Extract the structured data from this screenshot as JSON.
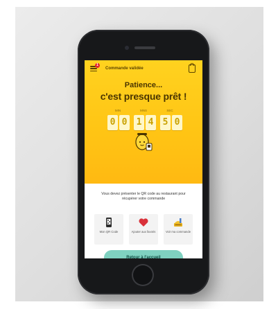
{
  "topbar": {
    "title": "Commande validée",
    "badge_count": "1"
  },
  "hero": {
    "line1": "Patience...",
    "line2": "c'est presque prêt !",
    "units": [
      "MIN",
      "MNS",
      "SEC"
    ],
    "digits": [
      "0",
      "0",
      "1",
      "4",
      "5",
      "0"
    ]
  },
  "info": {
    "text": "Vous devez présenter le QR code au restaurant pour récupérer votre commande"
  },
  "tiles": [
    {
      "label": "Mon QR Code",
      "icon": "qr-phone-icon"
    },
    {
      "label": "Ajouter aux favoris",
      "icon": "heart-icon"
    },
    {
      "label": "Voir ma commande",
      "icon": "meal-icon"
    }
  ],
  "cta": {
    "label": "Retour à l'accueil"
  },
  "colors": {
    "brand_yellow": "#ffc414",
    "cta_teal": "#7fd1c0",
    "badge_red": "#e3262f"
  }
}
